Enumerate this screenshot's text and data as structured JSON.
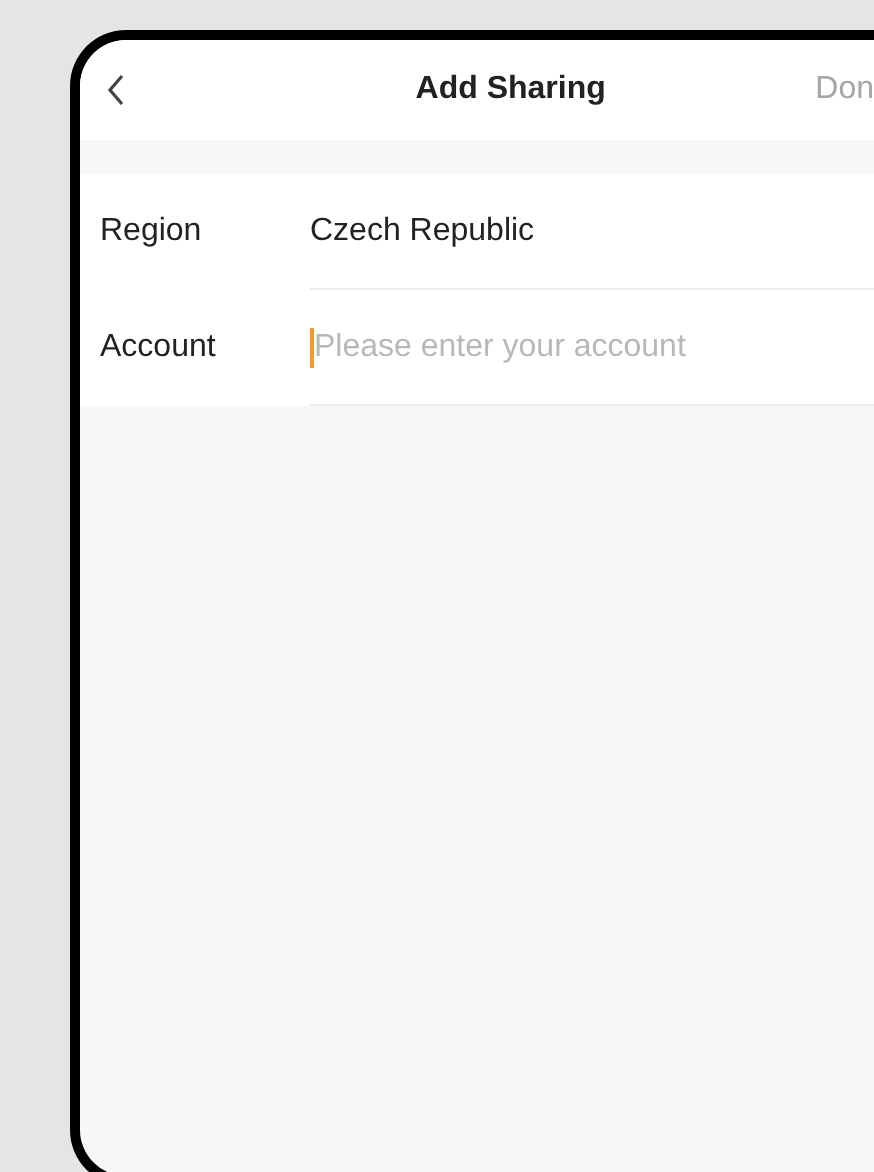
{
  "header": {
    "title": "Add Sharing",
    "action": {
      "label": "Don",
      "disabled": true
    }
  },
  "form": [
    {
      "kind": "value",
      "label": "Region",
      "value": "Czech Republic"
    },
    {
      "kind": "input",
      "label": "Account",
      "placeholder": "Please enter your account",
      "focused": true
    }
  ]
}
